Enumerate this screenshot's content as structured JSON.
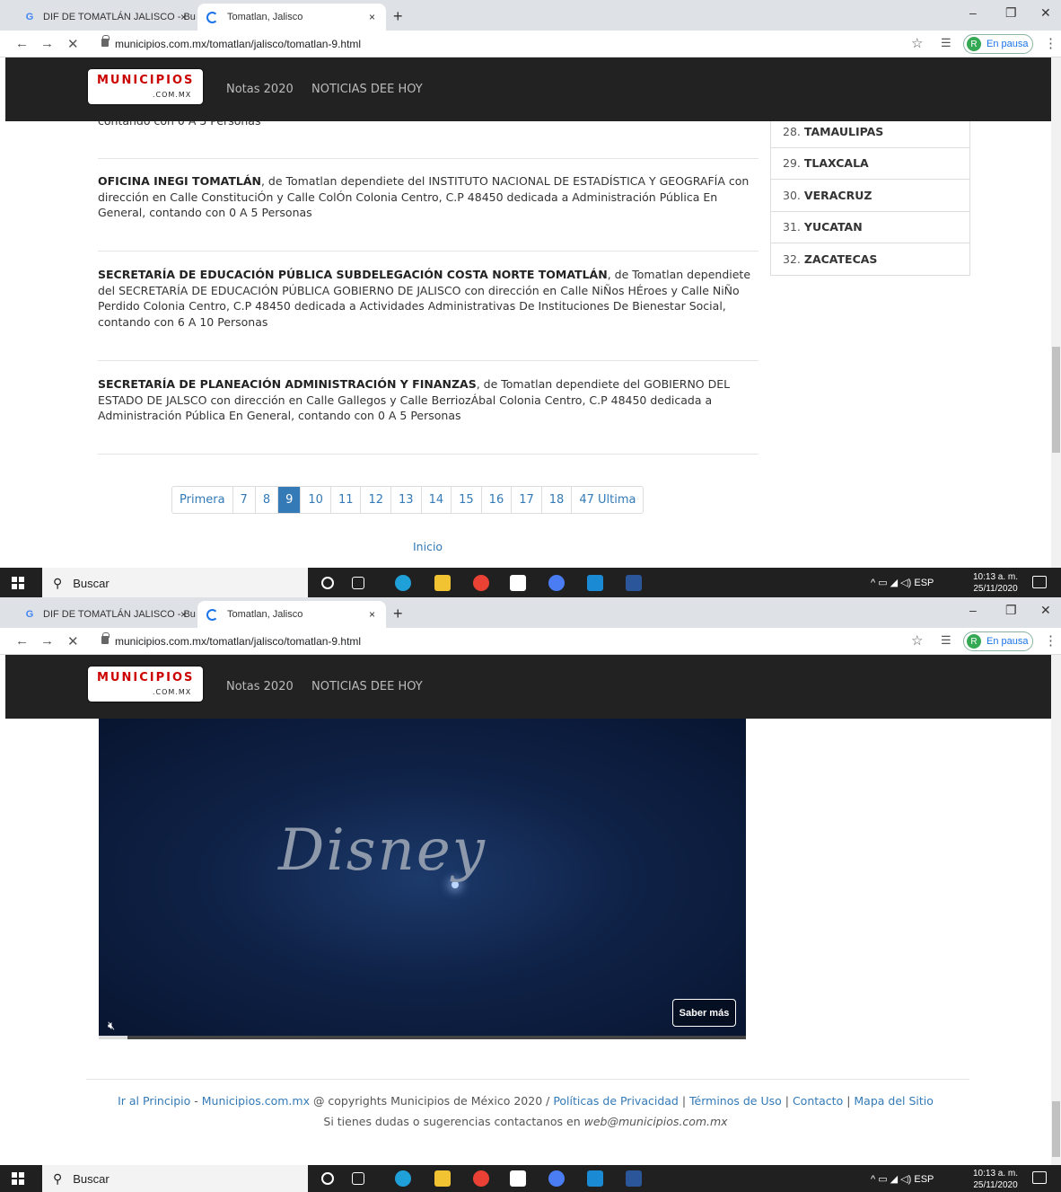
{
  "browser": {
    "tabs": [
      {
        "title": "DIF DE TOMATLÁN JALISCO - Bu",
        "close": "×"
      },
      {
        "title": "Tomatlan, Jalisco",
        "close": "×"
      }
    ],
    "new_tab": "+",
    "url": "municipios.com.mx/tomatlan/jalisco/tomatlan-9.html",
    "profile_initial": "R",
    "profile_status": "En pausa",
    "controls": {
      "minimize": "–",
      "restore": "❐",
      "close": "✕"
    }
  },
  "site": {
    "logo_main": "MUNICIPIOS",
    "logo_sub": ".COM.MX",
    "nav": [
      "Notas 2020",
      "NOTICIAS DEE HOY"
    ]
  },
  "entries": [
    {
      "name": "OFICINA INEGI TOMATLÁN",
      "text": ", de Tomatlan dependiete del INSTITUTO NACIONAL DE ESTADÍSTICA Y GEOGRAFÍA con dirección en Calle ConstituciÓn y Calle ColÓn Colonia Centro, C.P 48450 dedicada a Administración Pública En General, contando con 0 A 5 Personas"
    },
    {
      "name": "SECRETARÍA DE EDUCACIÓN PÚBLICA SUBDELEGACIÓN COSTA NORTE TOMATLÁN",
      "text": ", de Tomatlan dependiete del SECRETARÍA DE EDUCACIÓN PÚBLICA GOBIERNO DE JALISCO con dirección en Calle NiÑos HÉroes y Calle NiÑo Perdido Colonia Centro, C.P 48450 dedicada a Actividades Administrativas De Instituciones De Bienestar Social, contando con 6 A 10 Personas"
    },
    {
      "name": "SECRETARÍA DE PLANEACIÓN ADMINISTRACIÓN Y FINANZAS",
      "text": ", de Tomatlan dependiete del GOBIERNO DEL ESTADO DE JALSCO con dirección en Calle Gallegos y Calle BerriozÁbal Colonia Centro, C.P 48450 dedicada a Administración Pública En General, contando con 0 A 5 Personas"
    }
  ],
  "partial_text": "contando con 0 A 5 Personas",
  "states": [
    {
      "num": "28.",
      "name": "TAMAULIPAS"
    },
    {
      "num": "29.",
      "name": "TLAXCALA"
    },
    {
      "num": "30.",
      "name": "VERACRUZ"
    },
    {
      "num": "31.",
      "name": "YUCATAN"
    },
    {
      "num": "32.",
      "name": "ZACATECAS"
    }
  ],
  "pagination": [
    "Primera",
    "7",
    "8",
    "9",
    "10",
    "11",
    "12",
    "13",
    "14",
    "15",
    "16",
    "17",
    "18",
    "47 Ultima"
  ],
  "pagination_active": "9",
  "inicio": "Inicio",
  "ad": {
    "brand": "Disney",
    "cta": "Saber más",
    "progress": 0.045
  },
  "footer": {
    "links1": [
      "Ir al Principio",
      "Municipios.com.mx"
    ],
    "copyright": " @ copyrights Municipios de México 2020 / ",
    "links2": [
      "Políticas de Privacidad",
      "Términos de Uso",
      "Contacto",
      "Mapa del Sitio"
    ],
    "sep": " | ",
    "line2_text": "Si tienes dudas o sugerencias contactanos en ",
    "email": "web@municipios.com.mx"
  },
  "taskbar": {
    "search": "Buscar",
    "lang": "ESP",
    "time": "10:13 a. m.",
    "date": "25/11/2020"
  },
  "colors": {
    "link": "#337ab7",
    "nav_bg": "#222222",
    "logo_red": "#cc0000"
  }
}
